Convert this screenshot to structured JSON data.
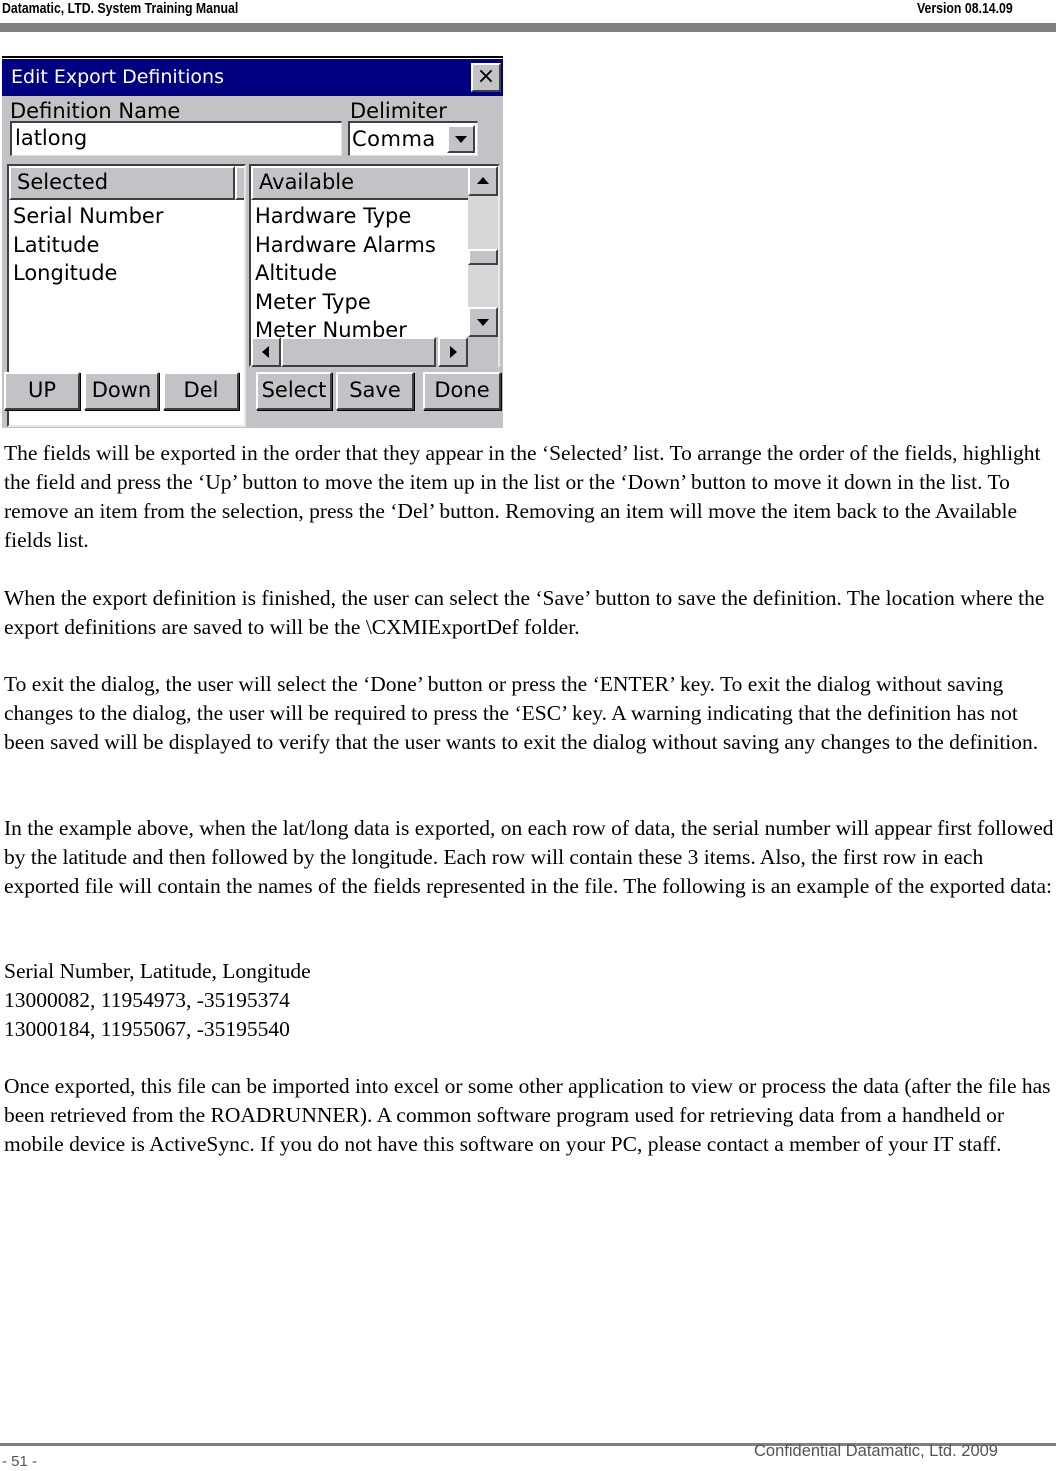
{
  "header": {
    "title": "Datamatic, LTD. System Training  Manual",
    "version": "Version 08.14.09"
  },
  "dialog": {
    "title": "Edit Export Definitions",
    "close_label": "×",
    "definition_name": {
      "label": "Definition Name",
      "value": "latlong"
    },
    "delimiter": {
      "label": "Delimiter",
      "selected": "Comma"
    },
    "selected_list": {
      "header": "Selected",
      "items": [
        "Serial Number",
        "Latitude",
        "Longitude"
      ]
    },
    "available_list": {
      "header": "Available",
      "items": [
        "Hardware Type",
        "Hardware Alarms",
        "Altitude",
        "Meter Type",
        "Meter Number"
      ]
    },
    "buttons": {
      "up": "UP",
      "down": "Down",
      "del": "Del",
      "select": "Select",
      "save": "Save",
      "done": "Done"
    }
  },
  "body": {
    "para1": "The fields will be exported in the order that they appear in the ‘Selected’ list.  To arrange the order of the fields, highlight the field and press the ‘Up’ button to move the item up in the list or the ‘Down’ button to move it down in the list.  To remove an item from the selection, press the ‘Del’ button.  Removing an item will move the item back to the Available fields list.",
    "para2": "When the export definition is finished, the user can select the ‘Save’ button to save the definition.  The location where the export definitions are saved to will be the \\CXMIExportDef folder.",
    "para3": "To exit the dialog, the user will select the ‘Done’ button or press the ‘ENTER’ key.  To exit the dialog without saving changes to the dialog, the user will be required to press the ‘ESC’ key.  A warning indicating that the definition has not been saved will be displayed to verify that the user wants to exit the dialog without saving any changes to the definition.",
    "para4": "In the example above, when the lat/long data is exported, on each row of data, the serial number will appear first followed by the latitude and then followed by the longitude.  Each row will contain these 3 items.  Also, the first row in each exported file will contain the names of the fields represented in the file.  The following is an example of the exported data:",
    "sample_lines": [
      "Serial Number, Latitude, Longitude",
      "13000082, 11954973, -35195374",
      "13000184, 11955067, -35195540"
    ],
    "para5": "Once exported, this file can be imported into excel or some other application to view or process the data (after the file has been retrieved from the ROADRUNNER).  A common software program used for retrieving data from a handheld or mobile device is ActiveSync.  If you do not have this software on your PC, please contact a member of your IT staff."
  },
  "footer": {
    "page": "- 51 -",
    "confidential": "Confidential Datamatic, Ltd. 2009"
  }
}
